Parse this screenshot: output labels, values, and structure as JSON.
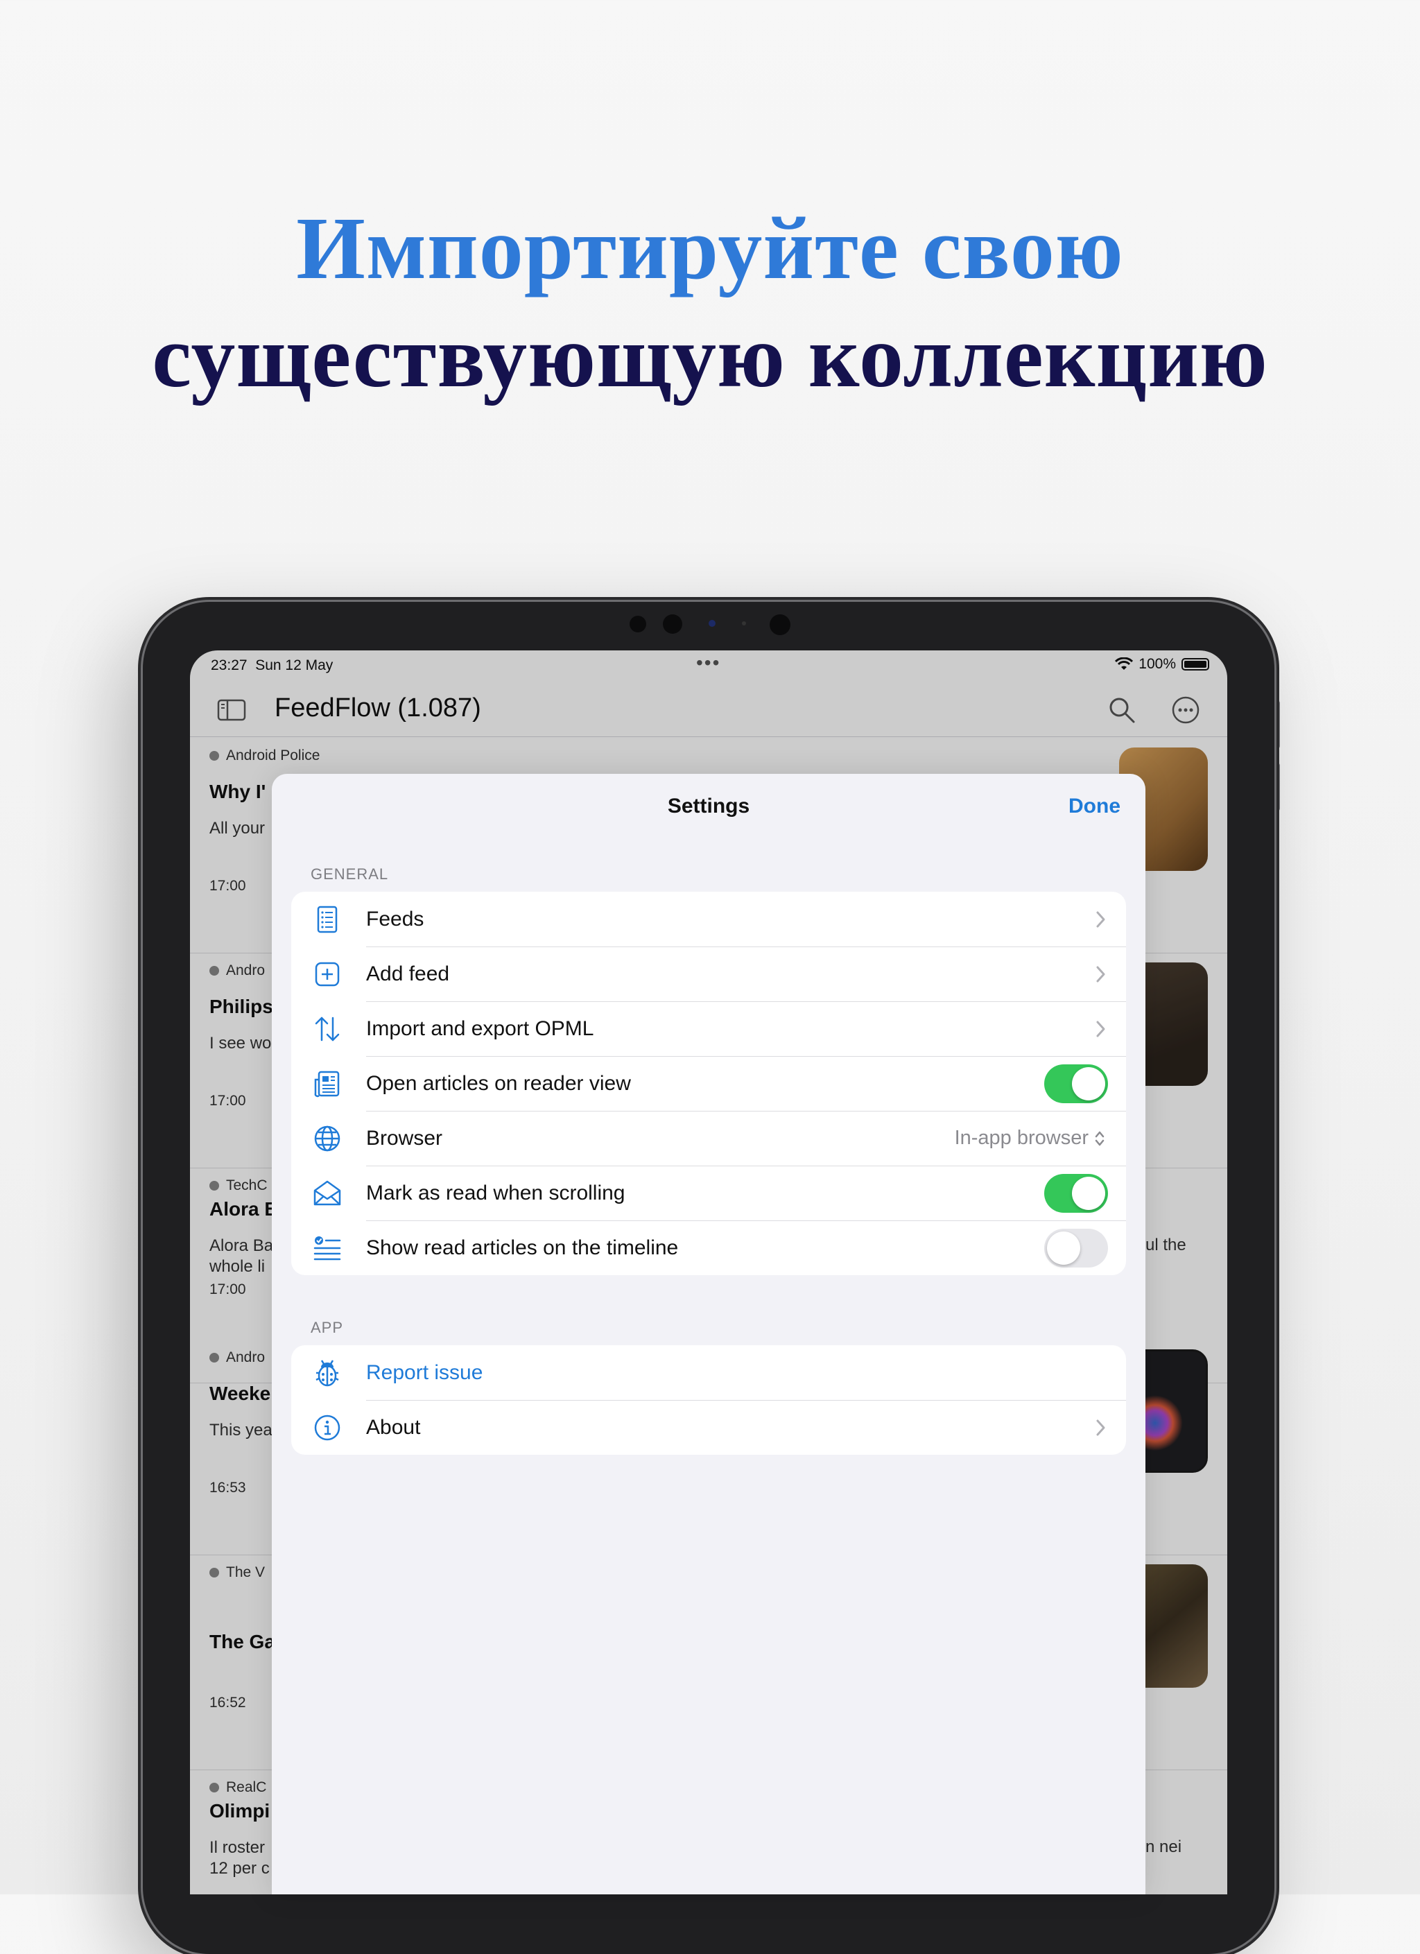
{
  "headline": {
    "line1": "Импортируйте свою",
    "line2": "существующую коллекцию"
  },
  "status_bar": {
    "time": "23:27",
    "date": "Sun 12 May",
    "battery": "100%"
  },
  "app": {
    "title": "FeedFlow  (1.087)"
  },
  "feed": {
    "items": [
      {
        "source": "Android Police",
        "title": "Why I'",
        "desc": "All your",
        "right_text": "",
        "time": "17:00"
      },
      {
        "source": "Andro",
        "title": "Philips",
        "desc": "I see wo",
        "right_text": "",
        "time": "17:00"
      },
      {
        "source": "TechC",
        "title": "Alora B",
        "desc": "Alora Ba\nwhole li",
        "right_text": "ul the",
        "time": "17:00"
      },
      {
        "source": "Andro",
        "title": "Weeke",
        "desc": "This yea",
        "right_text": "",
        "time": "16:53"
      },
      {
        "source": "The V",
        "title": "The Ga",
        "desc": "",
        "right_text": "",
        "time": "16:52"
      },
      {
        "source": "RealC",
        "title": "Olimpi",
        "desc": "Il roster\n12 per c",
        "right_text": "n nei",
        "time": ""
      }
    ]
  },
  "settings": {
    "title": "Settings",
    "done_label": "Done",
    "general_label": "GENERAL",
    "general": [
      {
        "icon": "list-icon",
        "label": "Feeds",
        "control": "chevron"
      },
      {
        "icon": "plus-square-icon",
        "label": "Add feed",
        "control": "chevron"
      },
      {
        "icon": "arrows-up-down-icon",
        "label": "Import and export OPML",
        "control": "chevron"
      },
      {
        "icon": "newspaper-icon",
        "label": "Open articles on reader view",
        "control": "toggle",
        "on": true
      },
      {
        "icon": "globe-icon",
        "label": "Browser",
        "control": "select",
        "value": "In-app browser"
      },
      {
        "icon": "envelope-open-icon",
        "label": "Mark as read when scrolling",
        "control": "toggle",
        "on": true
      },
      {
        "icon": "checklist-icon",
        "label": "Show read articles on the timeline",
        "control": "toggle",
        "on": false
      }
    ],
    "app_label": "APP",
    "app": [
      {
        "icon": "ladybug-icon",
        "label": "Report issue",
        "control": "none"
      },
      {
        "icon": "info-icon",
        "label": "About",
        "control": "chevron"
      }
    ]
  },
  "colors": {
    "accent": "#1f7bd8",
    "toggle_on": "#34c759",
    "headline_blue": "#2f7ad8",
    "headline_navy": "#15124e"
  }
}
